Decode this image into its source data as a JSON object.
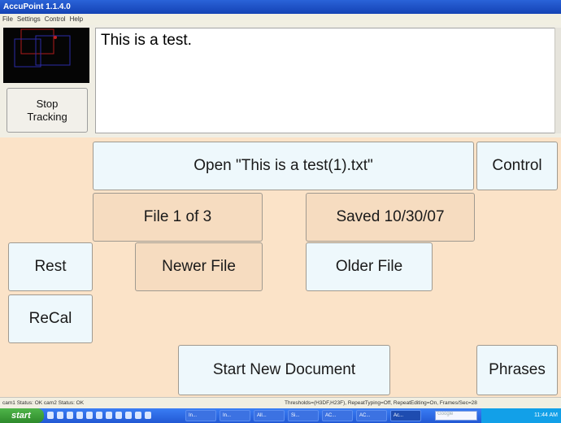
{
  "window": {
    "title": "AccuPoint 1.1.4.0"
  },
  "menu": [
    "File",
    "Settings",
    "Control",
    "Help"
  ],
  "tracking": {
    "stop_label_line1": "Stop",
    "stop_label_line2": "Tracking"
  },
  "document": {
    "text": "This is a test."
  },
  "buttons": {
    "open": "Open \"This is a test(1).txt\"",
    "control": "Control",
    "file_index": "File 1 of 3",
    "saved": "Saved 10/30/07",
    "rest": "Rest",
    "newer": "Newer File",
    "older": "Older File",
    "recal": "ReCal",
    "start_new": "Start New Document",
    "phrases": "Phrases"
  },
  "status": {
    "left": "cam1 Status: OK cam2 Status: OK",
    "right": "Thresholds=(H3DF,H23F), RepeatTyping=Off, RepeatEditing=On, Frames/Sec=28"
  },
  "taskbar": {
    "start": "start",
    "items": [
      "In...",
      "In...",
      "All...",
      "Si...",
      "AC...",
      "AC...",
      "Ac..."
    ],
    "search_placeholder": "Google",
    "clock": "11:44 AM"
  }
}
